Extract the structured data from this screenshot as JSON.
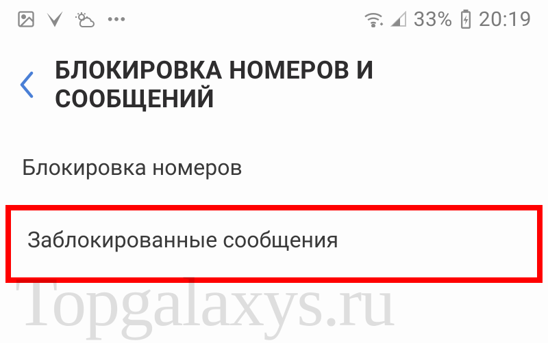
{
  "status": {
    "battery_percent": "33%",
    "clock": "20:19",
    "icons": {
      "image": "image-icon",
      "check": "checkmark-icon",
      "weather": "weather-icon",
      "more": "more-icon",
      "wifi": "wifi-icon",
      "signal": "cell-signal-icon",
      "battery": "battery-icon"
    }
  },
  "header": {
    "title": "БЛОКИРОВКА НОМЕРОВ И СООБЩЕНИЙ",
    "back_icon": "chevron-left-icon"
  },
  "rows": {
    "block_numbers": "Блокировка номеров",
    "blocked_messages": "Заблокированные сообщения"
  },
  "watermark": "Topgalaxys.ru"
}
